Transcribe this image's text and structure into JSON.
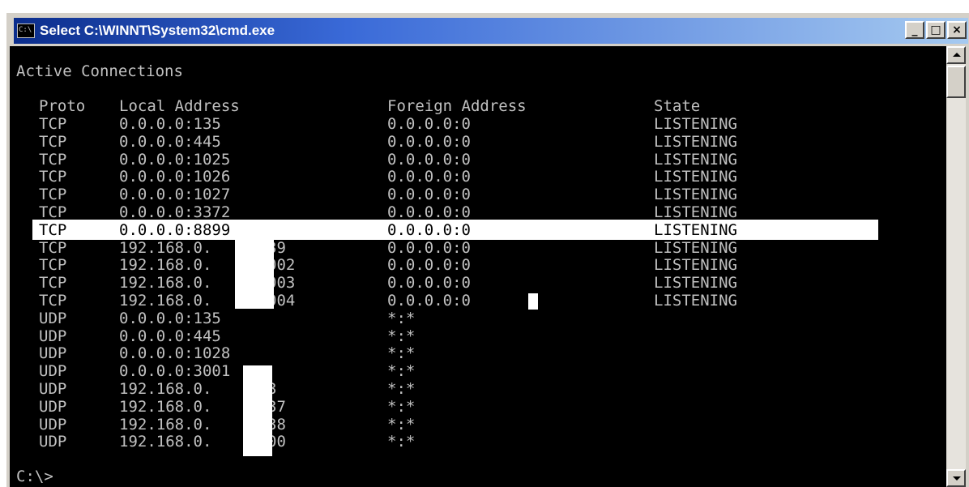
{
  "window": {
    "title": "Select C:\\WINNT\\System32\\cmd.exe",
    "icon_label": "C:\\",
    "buttons": {
      "minimize": "_",
      "maximize": "□",
      "close": "×"
    }
  },
  "console": {
    "heading": "Active Connections",
    "headers": {
      "proto": "Proto",
      "local": "Local Address",
      "foreign": "Foreign Address",
      "state": "State"
    },
    "rows": [
      {
        "proto": "TCP",
        "local": "0.0.0.0:135",
        "foreign": "0.0.0.0:0",
        "state": "LISTENING"
      },
      {
        "proto": "TCP",
        "local": "0.0.0.0:445",
        "foreign": "0.0.0.0:0",
        "state": "LISTENING"
      },
      {
        "proto": "TCP",
        "local": "0.0.0.0:1025",
        "foreign": "0.0.0.0:0",
        "state": "LISTENING"
      },
      {
        "proto": "TCP",
        "local": "0.0.0.0:1026",
        "foreign": "0.0.0.0:0",
        "state": "LISTENING"
      },
      {
        "proto": "TCP",
        "local": "0.0.0.0:1027",
        "foreign": "0.0.0.0:0",
        "state": "LISTENING"
      },
      {
        "proto": "TCP",
        "local": "0.0.0.0:3372",
        "foreign": "0.0.0.0:0",
        "state": "LISTENING"
      },
      {
        "proto": "TCP",
        "local": "0.0.0.0:8899",
        "foreign": "0.0.0.0:0",
        "state": "LISTENING",
        "highlighted": true
      },
      {
        "proto": "TCP",
        "local": "192.168.0.    :139",
        "foreign": "0.0.0.0:0",
        "state": "LISTENING"
      },
      {
        "proto": "TCP",
        "local": "192.168.0.    :3002",
        "foreign": "0.0.0.0:0",
        "state": "LISTENING"
      },
      {
        "proto": "TCP",
        "local": "192.168.0.    :3003",
        "foreign": "0.0.0.0:0",
        "state": "LISTENING"
      },
      {
        "proto": "TCP",
        "local": "192.168.0.    :3004",
        "foreign": "0.0.0.0:0",
        "state": "LISTENING"
      },
      {
        "proto": "UDP",
        "local": "0.0.0.0:135",
        "foreign": "*:*",
        "state": ""
      },
      {
        "proto": "UDP",
        "local": "0.0.0.0:445",
        "foreign": "*:*",
        "state": ""
      },
      {
        "proto": "UDP",
        "local": "0.0.0.0:1028",
        "foreign": "*:*",
        "state": ""
      },
      {
        "proto": "UDP",
        "local": "0.0.0.0:3001",
        "foreign": "*:*",
        "state": ""
      },
      {
        "proto": "UDP",
        "local": "192.168.0.    :53",
        "foreign": "*:*",
        "state": ""
      },
      {
        "proto": "UDP",
        "local": "192.168.0.    :137",
        "foreign": "*:*",
        "state": ""
      },
      {
        "proto": "UDP",
        "local": "192.168.0.    :138",
        "foreign": "*:*",
        "state": ""
      },
      {
        "proto": "UDP",
        "local": "192.168.0.    :500",
        "foreign": "*:*",
        "state": ""
      }
    ],
    "prompt": "C:\\>"
  },
  "colors": {
    "console_bg": "#000000",
    "console_text": "#c0c0c0",
    "selection": "#ffffff",
    "title_gradient_start": "#0b2d8c",
    "title_gradient_end": "#a6caf0"
  },
  "icons": {
    "window_icon": "cmd-window-icon",
    "scroll_up": "scroll-up-arrow-icon",
    "scroll_down": "scroll-down-arrow-icon"
  }
}
